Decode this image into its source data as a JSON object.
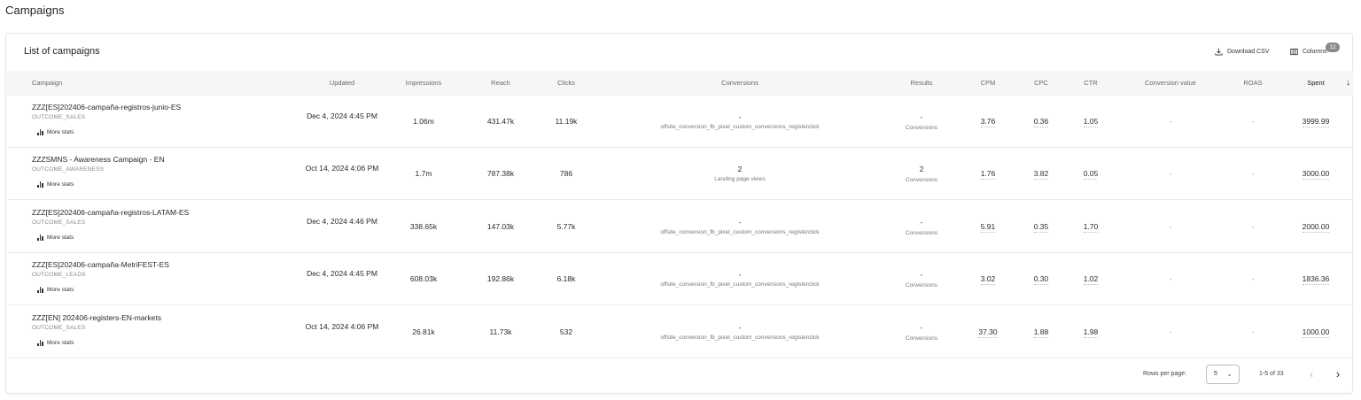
{
  "page": {
    "title": "Campaigns"
  },
  "card": {
    "title": "List of campaigns",
    "download_label": "Download CSV",
    "columns_label": "Columns",
    "columns_count": "12"
  },
  "headers": {
    "campaign": "Campaign",
    "updated": "Updated",
    "impressions": "Impressions",
    "reach": "Reach",
    "clicks": "Clicks",
    "conversions": "Conversions",
    "results": "Results",
    "cpm": "CPM",
    "cpc": "CPC",
    "ctr": "CTR",
    "conversion_value": "Conversion value",
    "roas": "ROAS",
    "spent": "Spent"
  },
  "more_stats_label": "More stats",
  "rows": [
    {
      "name": "ZZZ[ES]202406-campaña-registros-junio-ES",
      "objective": "OUTCOME_SALES",
      "updated": "Dec 4, 2024 4:45 PM",
      "impressions": "1.06m",
      "reach": "431.47k",
      "clicks": "11.19k",
      "conversions": "-",
      "conversions_sub": "offsite_conversion_fb_pixel_custom_conversions_registerclick",
      "results": "-",
      "results_sub": "Conversions",
      "cpm": "3.76",
      "cpc": "0.36",
      "ctr": "1.05",
      "conversion_value": "-",
      "roas": "-",
      "spent": "3999.99"
    },
    {
      "name": "ZZZSMNS - Awareness Campaign - EN",
      "objective": "OUTCOME_AWARENESS",
      "updated": "Oct 14, 2024 4:06 PM",
      "impressions": "1.7m",
      "reach": "787.38k",
      "clicks": "786",
      "conversions": "2",
      "conversions_sub": "Landing page views",
      "results": "2",
      "results_sub": "Conversions",
      "cpm": "1.76",
      "cpc": "3.82",
      "ctr": "0.05",
      "conversion_value": "-",
      "roas": "-",
      "spent": "3000.00"
    },
    {
      "name": "ZZZ[ES]202406-campaña-registros-LATAM-ES",
      "objective": "OUTCOME_SALES",
      "updated": "Dec 4, 2024 4:46 PM",
      "impressions": "338.65k",
      "reach": "147.03k",
      "clicks": "5.77k",
      "conversions": "-",
      "conversions_sub": "offsite_conversion_fb_pixel_custom_conversions_registerclick",
      "results": "-",
      "results_sub": "Conversions",
      "cpm": "5.91",
      "cpc": "0.35",
      "ctr": "1.70",
      "conversion_value": "-",
      "roas": "-",
      "spent": "2000.00"
    },
    {
      "name": "ZZZ[ES]202406-campaña-MetriFEST-ES",
      "objective": "OUTCOME_LEADS",
      "updated": "Dec 4, 2024 4:45 PM",
      "impressions": "608.03k",
      "reach": "192.86k",
      "clicks": "6.18k",
      "conversions": "-",
      "conversions_sub": "offsite_conversion_fb_pixel_custom_conversions_registerclick",
      "results": "-",
      "results_sub": "Conversions",
      "cpm": "3.02",
      "cpc": "0.30",
      "ctr": "1.02",
      "conversion_value": "-",
      "roas": "-",
      "spent": "1836.36"
    },
    {
      "name": "ZZZ[EN] 202406-registers-EN-markets",
      "objective": "OUTCOME_SALES",
      "updated": "Oct 14, 2024 4:06 PM",
      "impressions": "26.81k",
      "reach": "11.73k",
      "clicks": "532",
      "conversions": "-",
      "conversions_sub": "offsite_conversion_fb_pixel_custom_conversions_registerclick",
      "results": "-",
      "results_sub": "Conversions",
      "cpm": "37.30",
      "cpc": "1.88",
      "ctr": "1.98",
      "conversion_value": "-",
      "roas": "-",
      "spent": "1000.00"
    }
  ],
  "pagination": {
    "rows_per_page_label": "Rows per page:",
    "rows_per_page_value": "5",
    "range": "1-5 of 33"
  },
  "icons": {
    "download": "download-icon",
    "columns": "columns-icon",
    "sort": "arrow-down-icon",
    "more_stats": "bar-chart-icon",
    "prev": "chevron-left-icon",
    "next": "chevron-right-icon",
    "select": "chevron-down-icon"
  }
}
